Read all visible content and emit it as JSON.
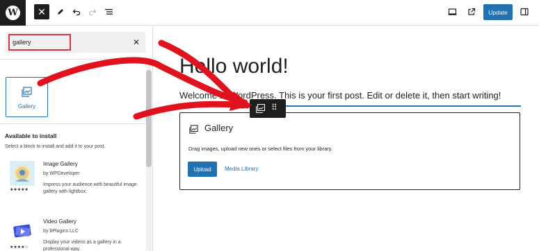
{
  "topbar": {
    "logo_letter": "W",
    "close_glyph": "✕",
    "update_label": "Update",
    "accent": "#2271b1"
  },
  "inserter": {
    "search_value": "gallery",
    "clear_glyph": "✕",
    "block_result": {
      "label": "Gallery",
      "icon": "gallery-icon"
    },
    "available_title": "Available to install",
    "available_desc": "Select a block to install and add it to your post.",
    "plugins": [
      {
        "name": "Image Gallery",
        "author": "by WPDeveloper",
        "rating": "★★★★★",
        "desc": "Impress your audience with beautiful image gallery with lightbox."
      },
      {
        "name": "Video Gallery",
        "author": "by bPlugins LLC",
        "rating": "★★★★☆",
        "desc": "Display your videos as a gallery in a professional way."
      }
    ]
  },
  "canvas": {
    "title": "Hello world!",
    "paragraph": "Welcome to WordPress. This is your first post. Edit or delete it, then start writing!",
    "gallery_block": {
      "title": "Gallery",
      "instructions": "Drag images, upload new ones or select files from your library.",
      "upload_label": "Upload",
      "media_library_label": "Media Library"
    },
    "toolbar_drag_glyph": "⠿"
  },
  "annotation_color": "#e0121d"
}
